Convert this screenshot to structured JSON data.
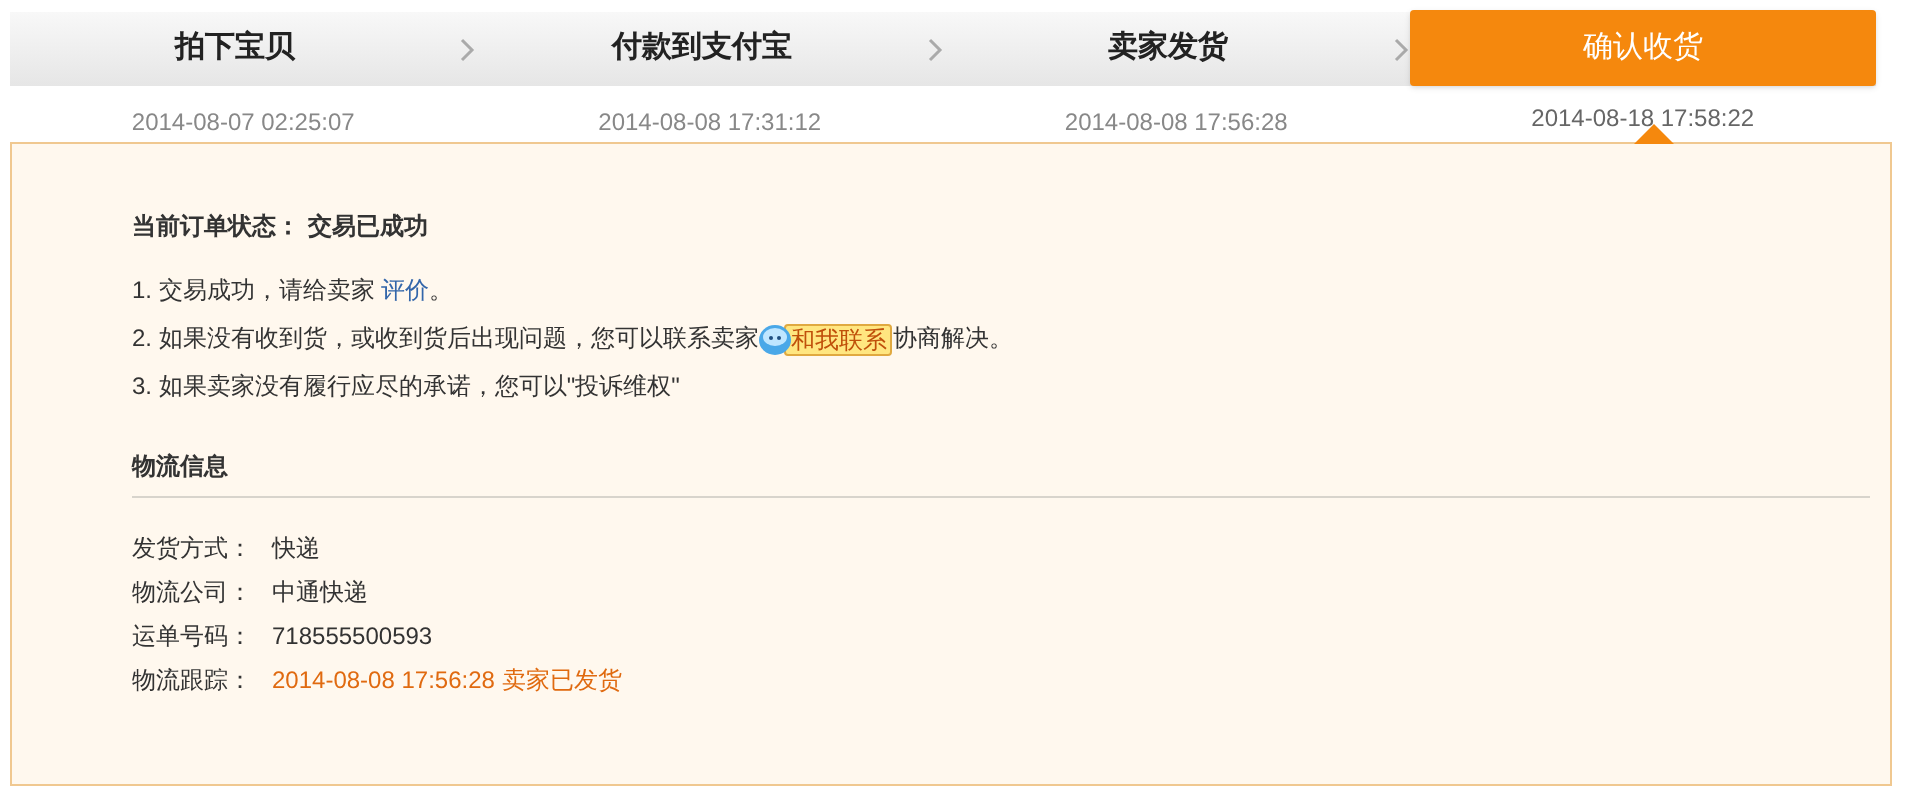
{
  "steps": [
    {
      "label": "拍下宝贝",
      "date": "2014-08-07 02:25:07",
      "selected": false
    },
    {
      "label": "付款到支付宝",
      "date": "2014-08-08 17:31:12",
      "selected": false
    },
    {
      "label": "卖家发货",
      "date": "2014-08-08 17:56:28",
      "selected": false
    },
    {
      "label": "确认收货",
      "date": "2014-08-18 17:58:22",
      "selected": true
    }
  ],
  "status": {
    "label": "当前订单状态：",
    "value": "交易已成功"
  },
  "notes": [
    {
      "parts": [
        {
          "kind": "text",
          "text": "1. 交易成功，请给卖家 "
        },
        {
          "kind": "link",
          "text": "评价"
        },
        {
          "kind": "text",
          "text": "。"
        }
      ]
    },
    {
      "parts": [
        {
          "kind": "text",
          "text": "2. 如果没有收到货，或收到货后出现问题，您可以联系卖家"
        },
        {
          "kind": "contact",
          "text": "和我联系"
        },
        {
          "kind": "text",
          "text": "协商解决。"
        }
      ]
    },
    {
      "parts": [
        {
          "kind": "text",
          "text": "3. 如果卖家没有履行应尽的承诺，您可以\"投诉维权\""
        }
      ]
    }
  ],
  "logistics": {
    "title": "物流信息",
    "rows": [
      {
        "label": "发货方式：",
        "value": "快递",
        "highlight": false
      },
      {
        "label": "物流公司：",
        "value": "中通快递",
        "highlight": false
      },
      {
        "label": "运单号码：",
        "value": "718555500593",
        "highlight": false
      },
      {
        "label": "物流跟踪：",
        "value": "2014-08-08 17:56:28 卖家已发货",
        "highlight": true
      }
    ]
  }
}
